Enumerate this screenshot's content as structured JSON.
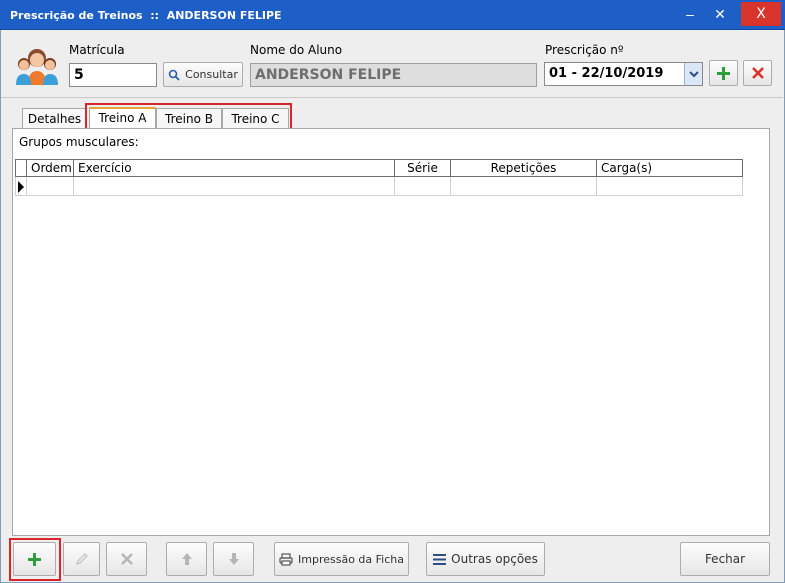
{
  "window": {
    "title": "Prescrição de Treinos  ::  ANDERSON FELIPE",
    "min_symbol": "–",
    "max_symbol": "✕",
    "close_symbol": "X"
  },
  "form": {
    "matricula_label": "Matrícula",
    "matricula_value": "5",
    "consultar_label": "Consultar",
    "nome_label": "Nome do Aluno",
    "nome_value": "ANDERSON FELIPE",
    "prescricao_label": "Prescrição nº",
    "prescricao_value": "01 - 22/10/2019"
  },
  "tabs": [
    {
      "label": "Detalhes"
    },
    {
      "label": "Treino A",
      "active": true
    },
    {
      "label": "Treino B"
    },
    {
      "label": "Treino C"
    }
  ],
  "panel": {
    "grupos_label": "Grupos musculares:",
    "columns": [
      "Ordem",
      "Exercício",
      "Série",
      "Repetições",
      "Carga(s)"
    ]
  },
  "footer": {
    "impressao_label": "Impressão da Ficha",
    "outras_label": "Outras opções",
    "fechar_label": "Fechar"
  },
  "colors": {
    "titlebar": "#1d5fc6",
    "close": "#d9342b",
    "highlight": "#d9242b",
    "green": "#2e9e3a",
    "red": "#d9342b"
  },
  "icons": {
    "consultar": "search-icon",
    "add": "plus-icon",
    "remove": "x-icon",
    "edit": "pencil-icon",
    "up": "arrow-up-icon",
    "down": "arrow-down-icon",
    "print": "printer-icon",
    "menu": "menu-icon"
  }
}
